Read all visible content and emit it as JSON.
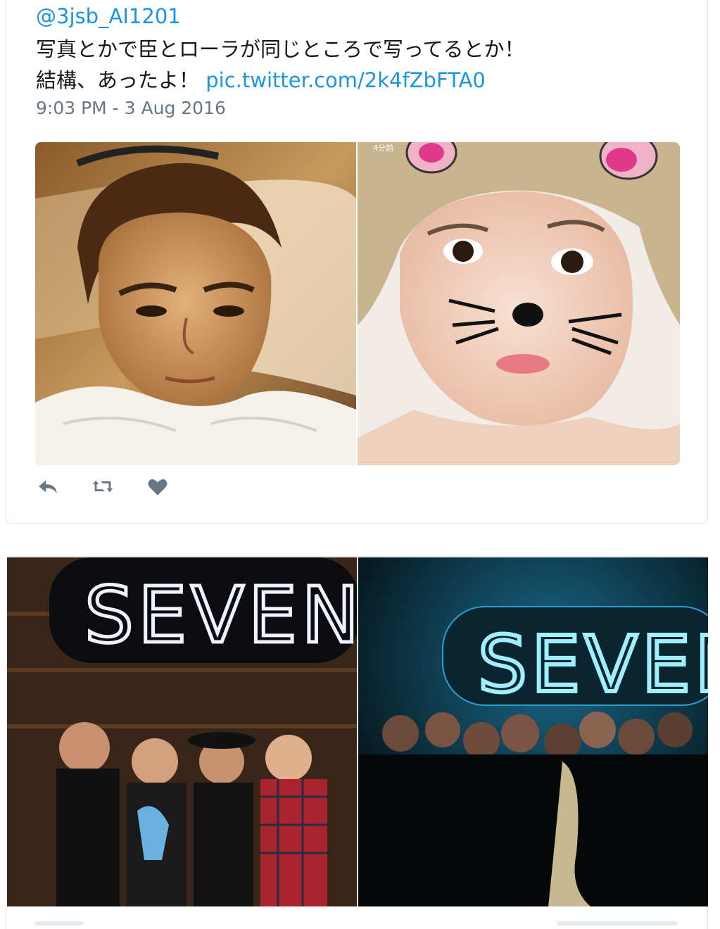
{
  "tweet": {
    "handle": "@3jsb_AI1201",
    "line1": "写真とかで臣とローラが同じところで写ってるとか！",
    "line2_text": "結構、あったよ！",
    "line2_link": "pic.twitter.com/2k4fZbFTA0",
    "timestamp": "9:03 PM - 3 Aug 2016",
    "photo_overlay_label": "4分前"
  },
  "actions": {
    "reply_icon": "reply-icon",
    "retweet_icon": "retweet-icon",
    "like_icon": "heart-icon"
  },
  "second_card": {
    "neon_sign_left": "SEVEN",
    "neon_sign_right": "SEVEN"
  },
  "colors": {
    "link": "#1b95e0",
    "text": "#14171a",
    "meta": "#657786",
    "icon": "#657786"
  }
}
